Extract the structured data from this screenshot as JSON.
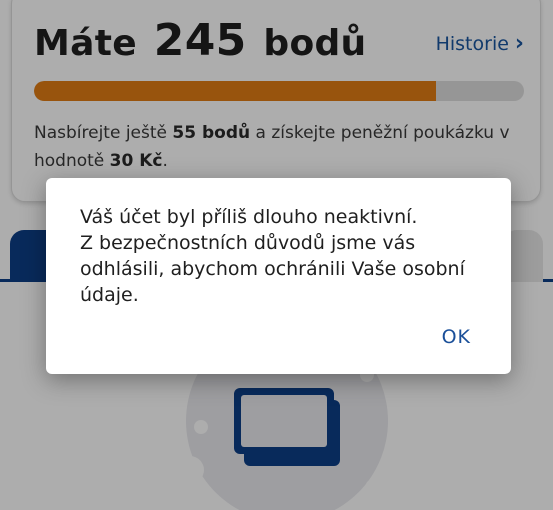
{
  "points_card": {
    "title_prefix": "Máte",
    "points": "245",
    "title_suffix": "bodů",
    "history_label": "Historie",
    "progress_fraction": 0.82,
    "note_part1": "Nasbírejte ještě ",
    "note_bold1": "55 bodů",
    "note_part2": " a získejte peněžní poukázku v hodnotě ",
    "note_bold2": "30 Kč",
    "note_part3": ".",
    "accent_color": "#e07c14",
    "link_color": "#1a56a0"
  },
  "tabs": {
    "active_color": "#0d3f87"
  },
  "dialog": {
    "message": "Váš účet byl příliš dlouho neaktivní.\nZ bezpečnostních důvodů jsme vás odhlásili, abychom ochránili Vaše osobní údaje.",
    "ok_label": "OK"
  }
}
